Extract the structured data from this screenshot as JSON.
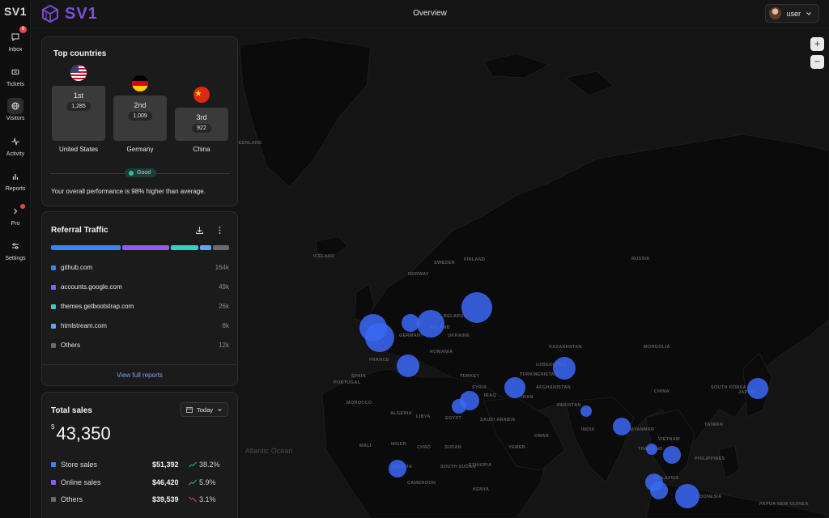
{
  "sidebar": {
    "logo": "SV1",
    "items": [
      {
        "label": "Inbox",
        "icon": "message-icon",
        "badge": "8"
      },
      {
        "label": "Tickets",
        "icon": "ticket-icon"
      },
      {
        "label": "Visitors",
        "icon": "globe-icon",
        "active": true
      },
      {
        "label": "Activity",
        "icon": "activity-icon"
      },
      {
        "label": "Reports",
        "icon": "bar-chart-icon"
      },
      {
        "label": "Pro",
        "icon": "chevron-right-icon"
      },
      {
        "label": "Settings",
        "icon": "sliders-icon"
      }
    ]
  },
  "header": {
    "brand": "SV1",
    "title": "Overview",
    "user": "user"
  },
  "map": {
    "labels": [
      "GREENLAND",
      "ICELAND",
      "RUSSIA",
      "KAZAKHSTAN",
      "MONGOLIA",
      "CHINA",
      "INDIA",
      "IRAN",
      "AFGHANISTAN",
      "PAKISTAN",
      "TURKEY",
      "UKRAINE",
      "BELARUS",
      "POLAND",
      "ROMANIA",
      "GERMANY",
      "FRANCE",
      "SPAIN",
      "PORTUGAL",
      "MOROCCO",
      "ALGERIA",
      "LIBYA",
      "EGYPT",
      "SAUDI ARABIA",
      "IRAQ",
      "SYRIA",
      "SUDAN",
      "CHAD",
      "NIGER",
      "MALI",
      "NIGERIA",
      "ETHIOPIA",
      "KENYA",
      "CAMEROON",
      "SOUTH SUDAN",
      "OMAN",
      "YEMEN",
      "TURKMENISTAN",
      "UZBEKISTAN",
      "MYANMAR",
      "THAILAND",
      "VIETNAM",
      "PHILIPPINES",
      "MALAYSIA",
      "INDONESIA",
      "PAPUA NEW GUINEA",
      "JAPAN",
      "SOUTH KOREA",
      "TAIWAN",
      "SWEDEN",
      "FINLAND",
      "NORWAY"
    ],
    "ocean": "Atlantic Ocean",
    "zoom_in": "+",
    "zoom_out": "−"
  },
  "top_countries": {
    "title": "Top countries",
    "countries": [
      {
        "rank": "1st",
        "count": "1,285",
        "name": "United States",
        "flag": "us-flag-icon"
      },
      {
        "rank": "2nd",
        "count": "1,009",
        "name": "Germany",
        "flag": "germany-flag-icon"
      },
      {
        "rank": "3rd",
        "count": "922",
        "name": "China",
        "flag": "china-flag-icon"
      }
    ],
    "status": "Good",
    "summary": "Your overall performance is 98% higher than average."
  },
  "referral": {
    "title": "Referral Traffic",
    "sources": [
      {
        "name": "github.com",
        "value": "164k",
        "color": "#3b82f6"
      },
      {
        "name": "accounts.google.com",
        "value": "49k",
        "color": "#8b5cf6"
      },
      {
        "name": "themes.getbootstrap.com",
        "value": "26k",
        "color": "#2dd4bf"
      },
      {
        "name": "htmlstream.com",
        "value": "8k",
        "color": "#60a5fa"
      },
      {
        "name": "Others",
        "value": "12k",
        "color": "#6b6b6b"
      }
    ],
    "bar_shares": [
      0.38,
      0.26,
      0.15,
      0.06,
      0.09
    ],
    "footer": "View full reports"
  },
  "sales": {
    "title": "Total sales",
    "period": "Today",
    "currency": "$",
    "total": "43,350",
    "rows": [
      {
        "name": "Store sales",
        "amount": "$51,392",
        "change": "38.2%",
        "trend": "up",
        "color": "#3b82f6"
      },
      {
        "name": "Online sales",
        "amount": "$46,420",
        "change": "5.9%",
        "trend": "up",
        "color": "#8b5cf6"
      },
      {
        "name": "Others",
        "amount": "$39,539",
        "change": "3.1%",
        "trend": "down",
        "color": "#6b6b6b"
      }
    ]
  },
  "colors": {
    "accent": "#7b4fd6",
    "bubble": "#3b68f6",
    "up": "#22c55e",
    "down": "#ef4444"
  }
}
